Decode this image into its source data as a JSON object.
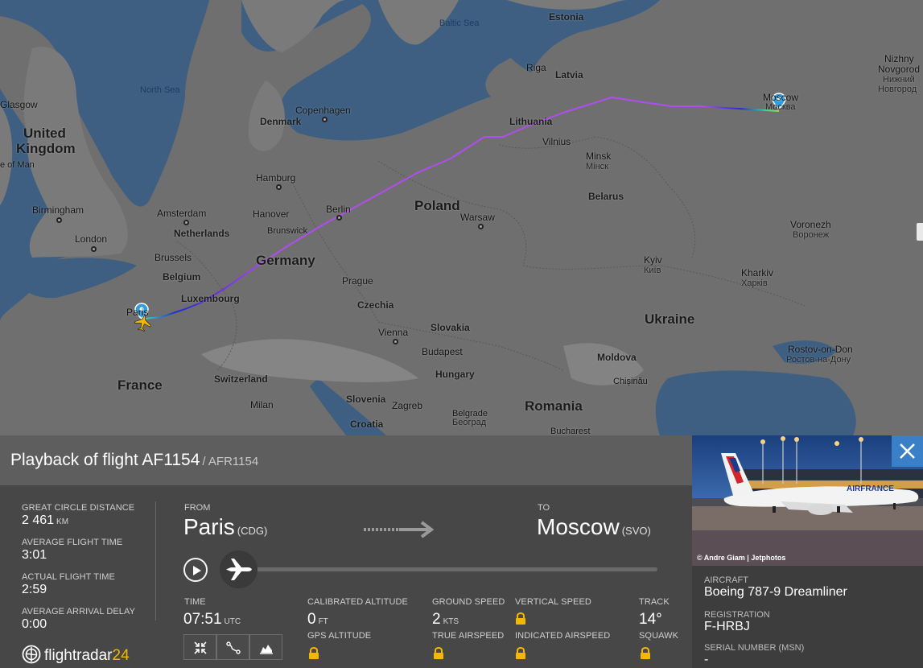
{
  "map": {
    "seas": {
      "north_sea": "North Sea",
      "baltic_sea": "Baltic Sea"
    },
    "countries": [
      "United Kingdom",
      "Denmark",
      "Netherlands",
      "Belgium",
      "Luxembourg",
      "Germany",
      "Poland",
      "Lithuania",
      "Latvia",
      "Estonia",
      "Belarus",
      "Ukraine",
      "France",
      "Czechia",
      "Slovakia",
      "Hungary",
      "Switzerland",
      "Slovenia",
      "Croatia",
      "Romania",
      "Moldova"
    ],
    "cities": {
      "glasgow": "Glasgow",
      "isle_of_man": "e of Man",
      "birmingham": "Birmingham",
      "london": "London",
      "copenhagen": "Copenhagen",
      "hamburg": "Hamburg",
      "amsterdam": "Amsterdam",
      "hanover": "Hanover",
      "berlin": "Berlin",
      "brunswick": "Brunswick",
      "brussels": "Brussels",
      "paris": "Paris",
      "prague": "Prague",
      "warsaw": "Warsaw",
      "vienna": "Vienna",
      "budapest": "Budapest",
      "milan": "Milan",
      "zagreb": "Zagreb",
      "riga": "Riga",
      "vilnius": "Vilnius",
      "minsk": "Minsk",
      "minsk_cyr": "Мінск",
      "kyiv": "Kyiv",
      "kyiv_cyr": "Київ",
      "kharkiv": "Kharkiv",
      "kharkiv_cyr": "Харків",
      "voronezh": "Voronezh",
      "voronezh_cyr": "Воронеж",
      "moscow": "Moscow",
      "moscow_cyr": "Москва",
      "nizhny": "Nizhny",
      "novgorod": "Novgorod",
      "nizhny_cyr": "Нижний",
      "novgorod_cyr": "Новгород",
      "rostov": "Rostov-on-Don",
      "rostov_cyr": "Ростов-на-Дону",
      "chisinau": "Chișinău",
      "beograd": "Београд",
      "belgrade": "Belgrade",
      "bucharest": "Bucharest"
    }
  },
  "flight": {
    "title": "Playback of flight AF1154",
    "callsign": "/ AFR1154"
  },
  "stats": {
    "distance_label": "GREAT CIRCLE DISTANCE",
    "distance_value": "2 461",
    "distance_unit": "KM",
    "avg_time_label": "AVERAGE FLIGHT TIME",
    "avg_time_value": "3:01",
    "actual_time_label": "ACTUAL FLIGHT TIME",
    "actual_time_value": "2:59",
    "delay_label": "AVERAGE ARRIVAL DELAY",
    "delay_value": "0:00"
  },
  "route": {
    "from_label": "FROM",
    "from_city": "Paris",
    "from_code": "(CDG)",
    "to_label": "TO",
    "to_city": "Moscow",
    "to_code": "(SVO)"
  },
  "telemetry": {
    "time_label": "TIME",
    "time_value": "07:51",
    "time_unit": "UTC",
    "cal_alt_label": "CALIBRATED ALTITUDE",
    "cal_alt_value": "0",
    "cal_alt_unit": "FT",
    "gps_alt_label": "GPS ALTITUDE",
    "ground_speed_label": "GROUND SPEED",
    "ground_speed_value": "2",
    "ground_speed_unit": "KTS",
    "true_airspeed_label": "TRUE AIRSPEED",
    "vertical_speed_label": "VERTICAL SPEED",
    "indicated_airspeed_label": "INDICATED AIRSPEED",
    "track_label": "TRACK",
    "track_value": "14°",
    "squawk_label": "SQUAWK"
  },
  "playback": {
    "progress": 0.0
  },
  "brand": {
    "name_a": "flightradar",
    "name_b": "24"
  },
  "aircraft": {
    "photo_credit": "© Andre Giam | Jetphotos",
    "aircraft_label": "AIRCRAFT",
    "aircraft_value": "Boeing 787-9 Dreamliner",
    "registration_label": "REGISTRATION",
    "registration_value": "F-HRBJ",
    "serial_label": "SERIAL NUMBER (MSN)",
    "serial_value": "-"
  },
  "colors": {
    "accent_blue": "#3a80c8",
    "brand_yellow": "#f5b800",
    "route_purple": "#b14cf0"
  }
}
